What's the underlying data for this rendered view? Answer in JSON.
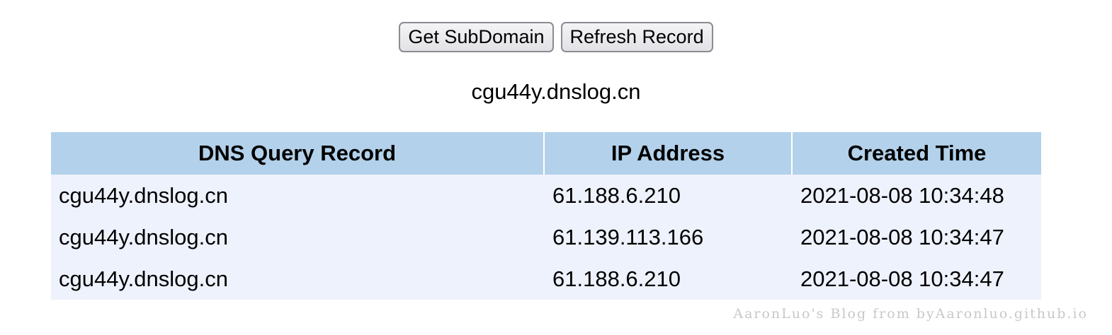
{
  "toolbar": {
    "get_subdomain_label": "Get SubDomain",
    "refresh_record_label": "Refresh Record"
  },
  "subdomain": "cgu44y.dnslog.cn",
  "table": {
    "headers": [
      "DNS Query Record",
      "IP Address",
      "Created Time"
    ],
    "rows": [
      [
        "cgu44y.dnslog.cn",
        "61.188.6.210",
        "2021-08-08 10:34:48"
      ],
      [
        "cgu44y.dnslog.cn",
        "61.139.113.166",
        "2021-08-08 10:34:47"
      ],
      [
        "cgu44y.dnslog.cn",
        "61.188.6.210",
        "2021-08-08 10:34:47"
      ]
    ]
  },
  "watermark": "AaronLuo's Blog from byAaronluo.github.io",
  "colors": {
    "header_bg": "#b3d1ea",
    "row_bg": "#eef2fd"
  }
}
